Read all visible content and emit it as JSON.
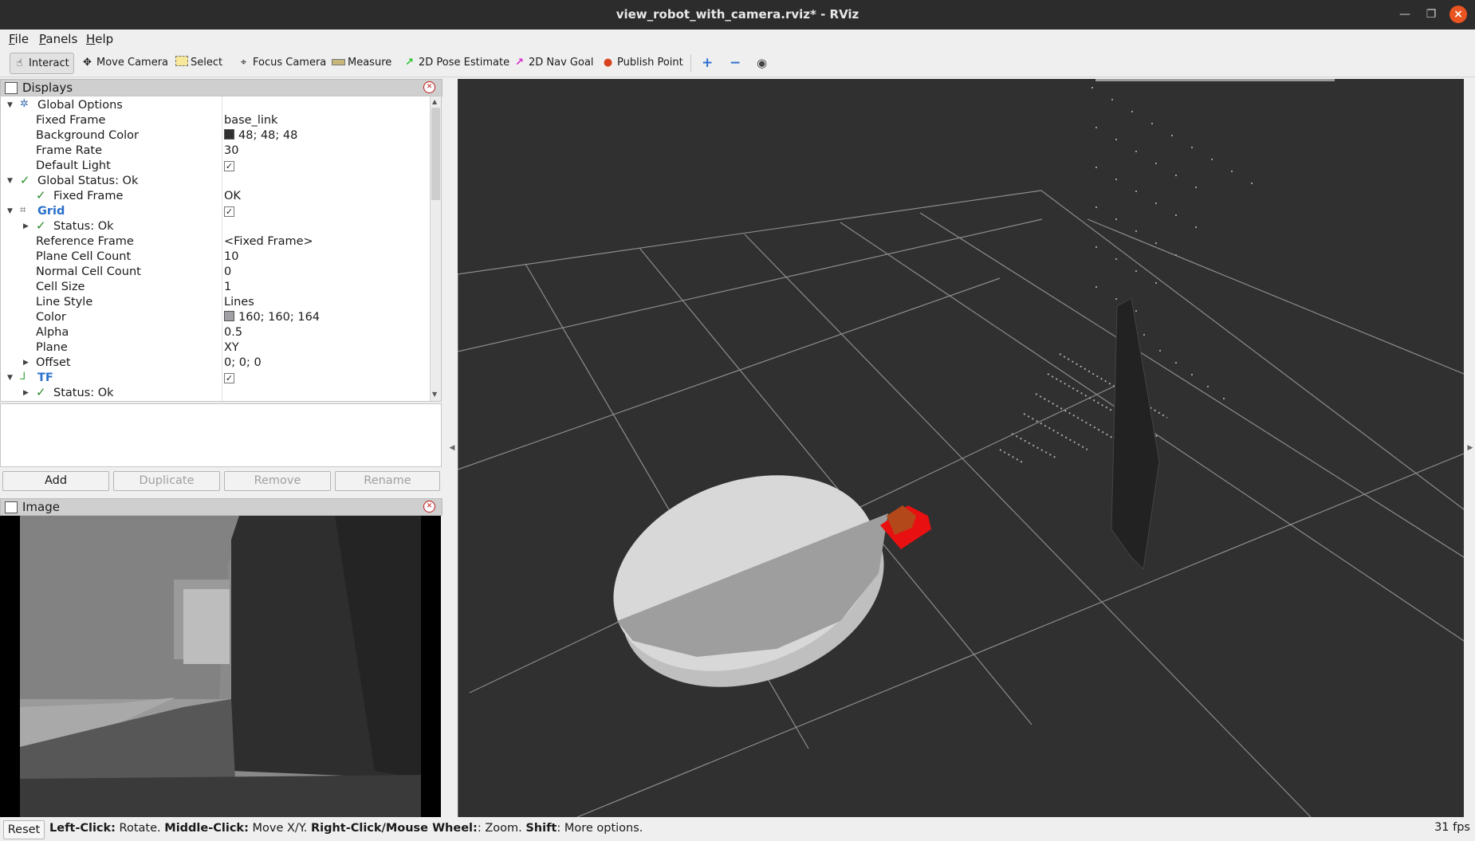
{
  "window": {
    "title": "view_robot_with_camera.rviz* - RViz"
  },
  "menu": [
    "File",
    "Panels",
    "Help"
  ],
  "toolbar": {
    "interact": "Interact",
    "move_camera": "Move Camera",
    "select": "Select",
    "focus_camera": "Focus Camera",
    "measure": "Measure",
    "pose_estimate": "2D Pose Estimate",
    "nav_goal": "2D Nav Goal",
    "publish_point": "Publish Point"
  },
  "displays": {
    "title": "Displays",
    "rows": [
      {
        "label": "Global Options",
        "value": ""
      },
      {
        "label": "Fixed Frame",
        "value": "base_link"
      },
      {
        "label": "Background Color",
        "value": "48; 48; 48",
        "swatch": "#303030"
      },
      {
        "label": "Frame Rate",
        "value": "30"
      },
      {
        "label": "Default Light",
        "checked": "✓"
      },
      {
        "label": "Global Status: Ok",
        "value": ""
      },
      {
        "label": "Fixed Frame",
        "value": "OK"
      },
      {
        "label": "Grid",
        "checked": "✓"
      },
      {
        "label": "Status: Ok",
        "value": ""
      },
      {
        "label": "Reference Frame",
        "value": "<Fixed Frame>"
      },
      {
        "label": "Plane Cell Count",
        "value": "10"
      },
      {
        "label": "Normal Cell Count",
        "value": "0"
      },
      {
        "label": "Cell Size",
        "value": "1"
      },
      {
        "label": "Line Style",
        "value": "Lines"
      },
      {
        "label": "Color",
        "value": "160; 160; 164",
        "swatch": "#a0a0a4"
      },
      {
        "label": "Alpha",
        "value": "0.5"
      },
      {
        "label": "Plane",
        "value": "XY"
      },
      {
        "label": "Offset",
        "value": "0; 0; 0"
      },
      {
        "label": "TF",
        "checked": "✓"
      },
      {
        "label": "Status: Ok",
        "value": ""
      }
    ]
  },
  "buttons": {
    "add": "Add",
    "duplicate": "Duplicate",
    "remove": "Remove",
    "rename": "Rename"
  },
  "image_panel": {
    "title": "Image"
  },
  "status": {
    "reset": "Reset",
    "k1": "Left-Click:",
    "t1": " Rotate. ",
    "k2": "Middle-Click:",
    "t2": " Move X/Y. ",
    "k3": "Right-Click/Mouse Wheel:",
    "t3": ": Zoom. ",
    "k4": "Shift",
    "t4": ": More options.",
    "fps": "31 fps"
  }
}
